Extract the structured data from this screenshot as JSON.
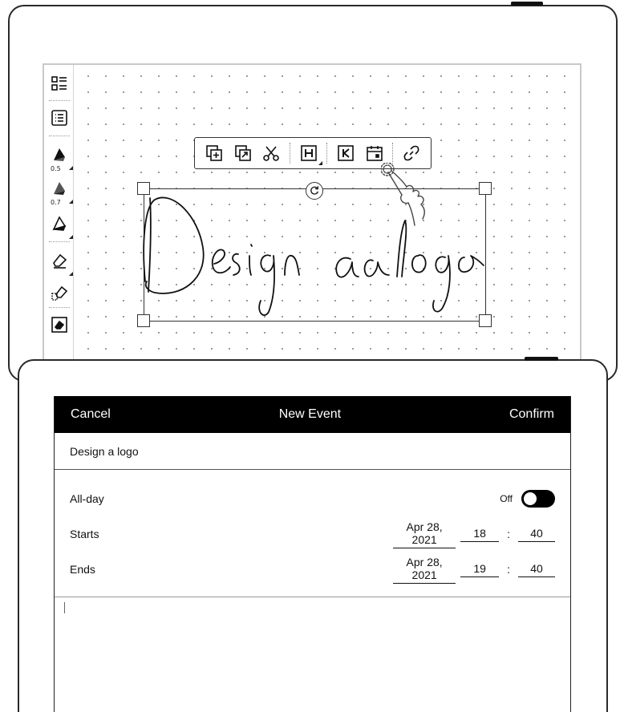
{
  "size_labels": [
    "0.5",
    "0.7"
  ],
  "handwriting_text": "Design a logo",
  "event_dialog": {
    "cancel_label": "Cancel",
    "title": "New Event",
    "confirm_label": "Confirm",
    "event_name": "Design a logo",
    "allday_label": "All-day",
    "allday_state": "Off",
    "starts_label": "Starts",
    "starts_date": "Apr 28, 2021",
    "starts_hour": "18",
    "starts_minute": "40",
    "ends_label": "Ends",
    "ends_date": "Apr 28, 2021",
    "ends_hour": "19",
    "ends_minute": "40",
    "time_separator": ":"
  }
}
